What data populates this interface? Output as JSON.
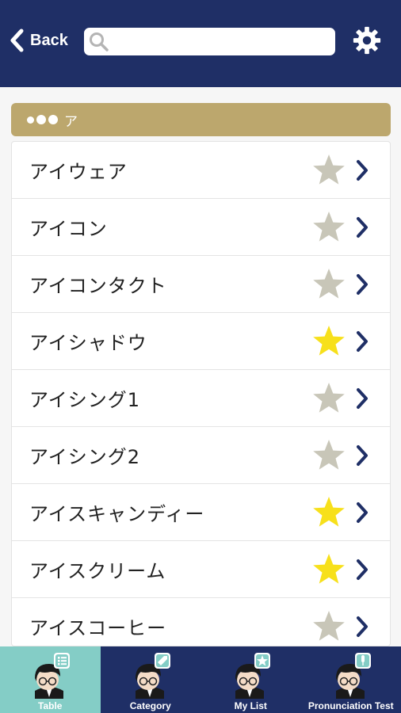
{
  "header": {
    "back_label": "Back",
    "search_placeholder": "",
    "settings_icon": "gear-icon"
  },
  "section": {
    "title": "ア"
  },
  "colors": {
    "header_bg": "#1f2f66",
    "section_bg": "#bca76d",
    "star_active": "#f7e01b",
    "star_inactive": "#c8c6b8",
    "chevron": "#1f2f66",
    "active_tab": "#84cdc6"
  },
  "list": [
    {
      "word": "アイウェア",
      "favorite": false
    },
    {
      "word": "アイコン",
      "favorite": false
    },
    {
      "word": "アイコンタクト",
      "favorite": false
    },
    {
      "word": "アイシャドウ",
      "favorite": true
    },
    {
      "word": "アイシング1",
      "favorite": false
    },
    {
      "word": "アイシング2",
      "favorite": false
    },
    {
      "word": "アイスキャンディー",
      "favorite": true
    },
    {
      "word": "アイスクリーム",
      "favorite": true
    },
    {
      "word": "アイスコーヒー",
      "favorite": false
    }
  ],
  "bottom_nav": {
    "tabs": [
      {
        "label": "Table",
        "active": true,
        "badge_icon": "list-icon"
      },
      {
        "label": "Category",
        "active": false,
        "badge_icon": "tag-icon"
      },
      {
        "label": "My List",
        "active": false,
        "badge_icon": "star-icon"
      },
      {
        "label": "Pronunciation Test",
        "active": false,
        "badge_icon": "microphone-icon"
      }
    ]
  }
}
